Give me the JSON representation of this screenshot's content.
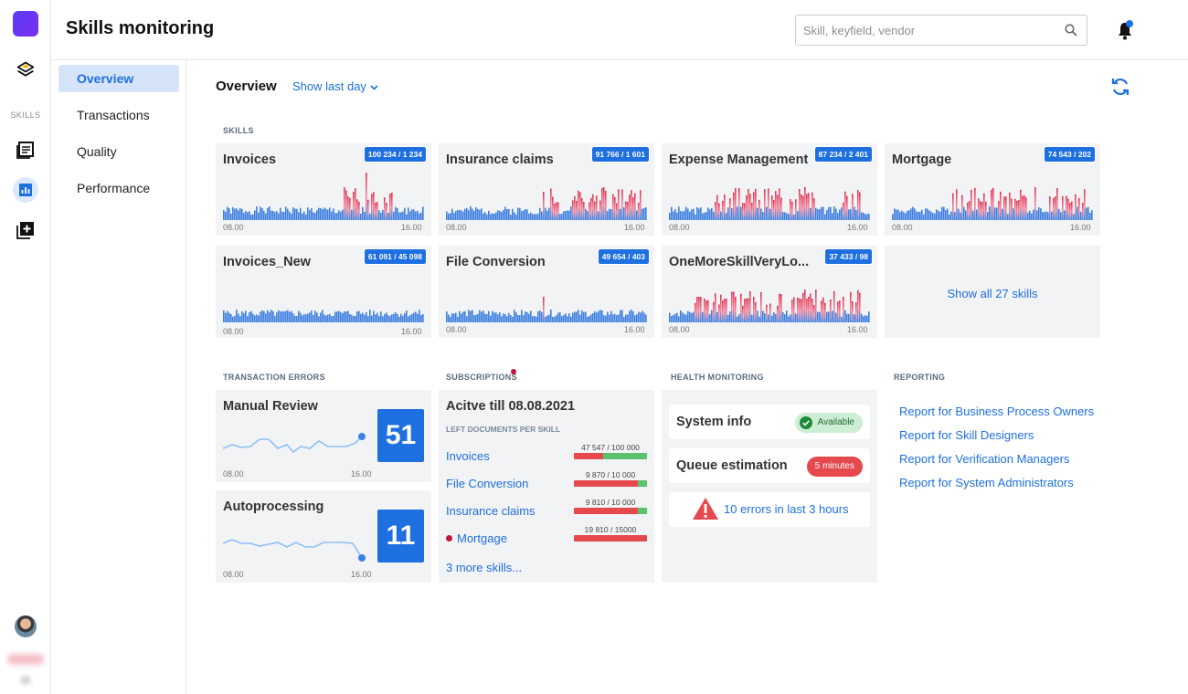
{
  "app": {
    "title": "Skills monitoring"
  },
  "search": {
    "placeholder": "Skill, keyfield, vendor"
  },
  "rail": {
    "skills_label": "SKILLS"
  },
  "subnav": [
    {
      "label": "Overview",
      "active": true
    },
    {
      "label": "Transactions",
      "active": false
    },
    {
      "label": "Quality",
      "active": false
    },
    {
      "label": "Performance",
      "active": false
    }
  ],
  "overview": {
    "heading": "Overview",
    "range_label": "Show last day"
  },
  "sections": {
    "skills": "SKILLS",
    "errors": "TRANSACTION ERRORS",
    "subscriptions": "SUBSCRIPTIONS",
    "health": "HEALTH MONITORING",
    "reporting": "REPORTING"
  },
  "chart_ticks": {
    "start": "08.00",
    "end": "16.00"
  },
  "skills": [
    {
      "name": "Invoices",
      "badge": "100 234 / 1 234"
    },
    {
      "name": "Insurance claims",
      "badge": "91 766 / 1 601"
    },
    {
      "name": "Expense Management",
      "badge": "87 234 / 2 401"
    },
    {
      "name": "Mortgage",
      "badge": "74 543 / 202"
    },
    {
      "name": "Invoices_New",
      "badge": "61 091 / 45 098"
    },
    {
      "name": "File Conversion",
      "badge": "49 654 / 403"
    },
    {
      "name": "OneMoreSkillVeryLo...",
      "badge": "37 433 / 98"
    }
  ],
  "show_all": "Show all 27 skills",
  "errors": [
    {
      "title": "Manual Review",
      "value": "51"
    },
    {
      "title": "Autoprocessing",
      "value": "11"
    }
  ],
  "subscriptions": {
    "title": "Acitve till 08.08.2021",
    "caption": "LEFT DOCUMENTS PER SKILL",
    "items": [
      {
        "name": "Invoices",
        "count": "47 547 / 100 000",
        "fraction_left": 0.6
      },
      {
        "name": "File Conversion",
        "count": "9 870 / 10 000",
        "fraction_left": 0.12
      },
      {
        "name": "Insurance claims",
        "count": "9 810 / 10 000",
        "fraction_left": 0.12
      },
      {
        "name": "Mortgage",
        "count": "19 810 / 15000",
        "fraction_left": 0
      }
    ],
    "more": "3 more skills..."
  },
  "health": {
    "system_label": "System info",
    "system_status": "Available",
    "queue_label": "Queue estimation",
    "queue_value": "5 minutes",
    "errors_link": "10 errors in last 3 hours"
  },
  "reports": [
    "Report for Business Process Owners",
    "Report for Skill Designers",
    "Report for Verification Managers",
    "Report for System Administrators"
  ]
}
